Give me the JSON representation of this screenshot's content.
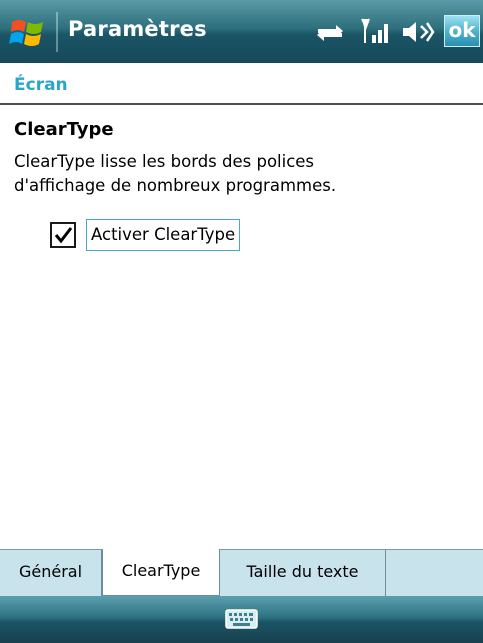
{
  "titlebar": {
    "title": "Paramètres",
    "ok_label": "ok",
    "icons": [
      "windows-start-icon",
      "data-sync-icon",
      "signal-icon",
      "volume-icon"
    ]
  },
  "page": {
    "header": "Écran"
  },
  "content": {
    "section_title": "ClearType",
    "description_line1": "ClearType lisse les bords des polices",
    "description_line2": "d'affichage de nombreux programmes.",
    "checkbox_label": "Activer ClearType",
    "checkbox_checked": true
  },
  "tabs": [
    {
      "label": "Général",
      "active": false
    },
    {
      "label": "ClearType",
      "active": true
    },
    {
      "label": "Taille du texte",
      "active": false
    }
  ],
  "menubar": {
    "icon": "keyboard-icon"
  },
  "colors": {
    "header_accent": "#2aa6c8",
    "titlebar_dark": "#17495a",
    "tab_strip": "#c9e3ec"
  }
}
